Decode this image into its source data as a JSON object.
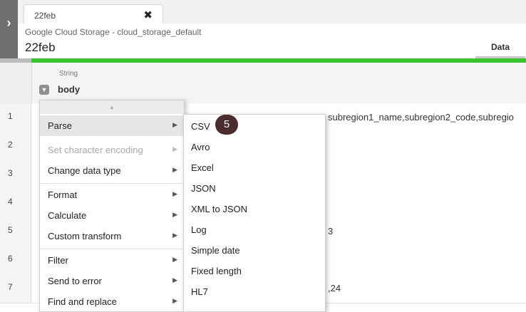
{
  "tab": {
    "label": "22feb",
    "close_icon": "close-icon"
  },
  "header": {
    "subtitle": "Google Cloud Storage - cloud_storage_default",
    "title": "22feb",
    "data_tab": "Data"
  },
  "colors": {
    "accent": "#37c42e",
    "badge": "#4a2b2e"
  },
  "column": {
    "type": "String",
    "name": "body"
  },
  "rows": [
    {
      "num": "1",
      "text": "subregion1_name,subregion2_code,subregio"
    },
    {
      "num": "2",
      "text": ""
    },
    {
      "num": "3",
      "text": ""
    },
    {
      "num": "4",
      "text": ""
    },
    {
      "num": "5",
      "text": "3"
    },
    {
      "num": "6",
      "text": ""
    },
    {
      "num": "7",
      "text": ",24"
    }
  ],
  "menu": {
    "items": [
      {
        "label": "Parse"
      },
      {
        "label": "Set character encoding"
      },
      {
        "label": "Change data type"
      },
      {
        "label": "Format"
      },
      {
        "label": "Calculate"
      },
      {
        "label": "Custom transform"
      },
      {
        "label": "Filter"
      },
      {
        "label": "Send to error"
      },
      {
        "label": "Find and replace"
      }
    ]
  },
  "submenu": {
    "items": [
      {
        "label": "CSV"
      },
      {
        "label": "Avro"
      },
      {
        "label": "Excel"
      },
      {
        "label": "JSON"
      },
      {
        "label": "XML to JSON"
      },
      {
        "label": "Log"
      },
      {
        "label": "Simple date"
      },
      {
        "label": "Fixed length"
      },
      {
        "label": "HL7"
      }
    ]
  },
  "step_badge": "5"
}
